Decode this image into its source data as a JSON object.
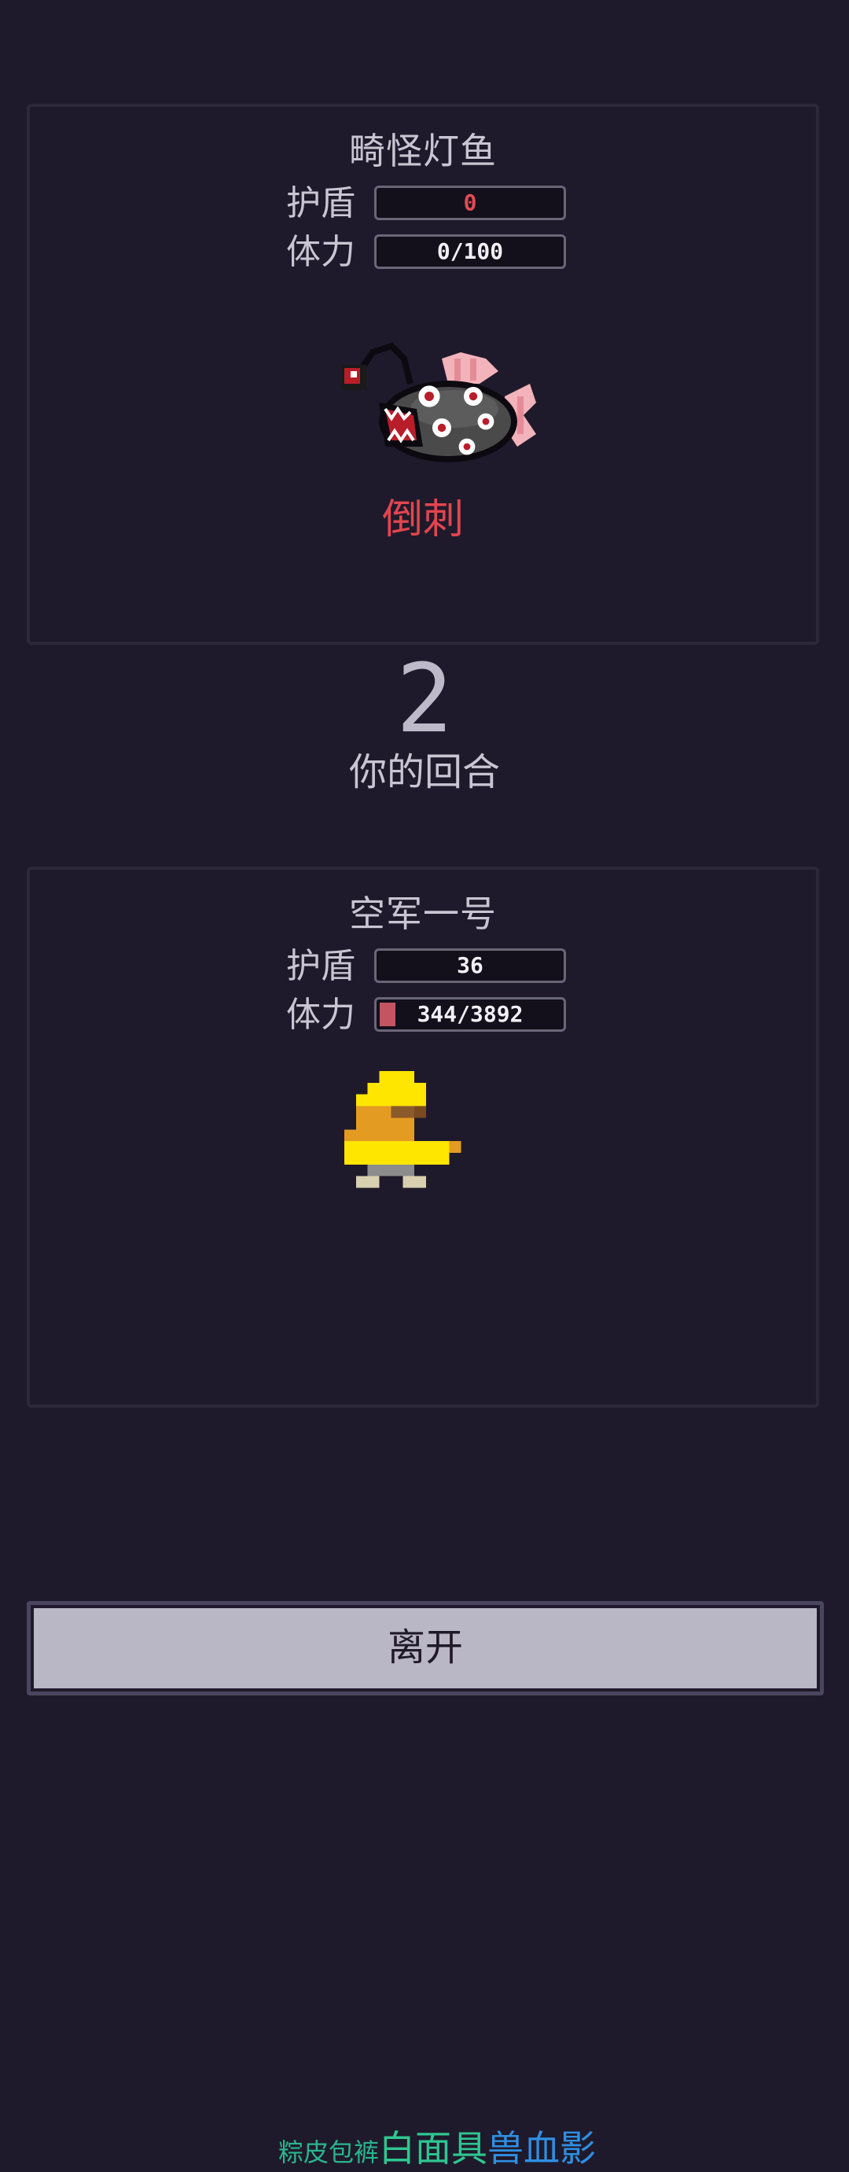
{
  "enemy": {
    "name": "畸怪灯鱼",
    "shield_label": "护盾",
    "shield_value": "0",
    "hp_label": "体力",
    "hp_value": "0/100",
    "hp_fraction": 0,
    "status": "倒刺",
    "sprite": "anglerfish-sprite"
  },
  "round": {
    "number": "2",
    "label": "你的回合"
  },
  "player": {
    "name": "空军一号",
    "shield_label": "护盾",
    "shield_value": "36",
    "hp_label": "体力",
    "hp_value": "344/3892",
    "hp_fraction": 0.088,
    "sprite": "yellow-duck-sprite",
    "status_parts": [
      "粽皮包裤",
      "白面具",
      "兽血影"
    ]
  },
  "actions": {
    "leave_label": "离开"
  },
  "colors": {
    "background": "#1f1a2b",
    "panel_border": "#2d2839",
    "status_red": "#e2454f",
    "status_green": "#2ec690",
    "status_blue": "#2f8fe3",
    "hp_fill": "#c45560",
    "button": "#b9b6c6"
  }
}
